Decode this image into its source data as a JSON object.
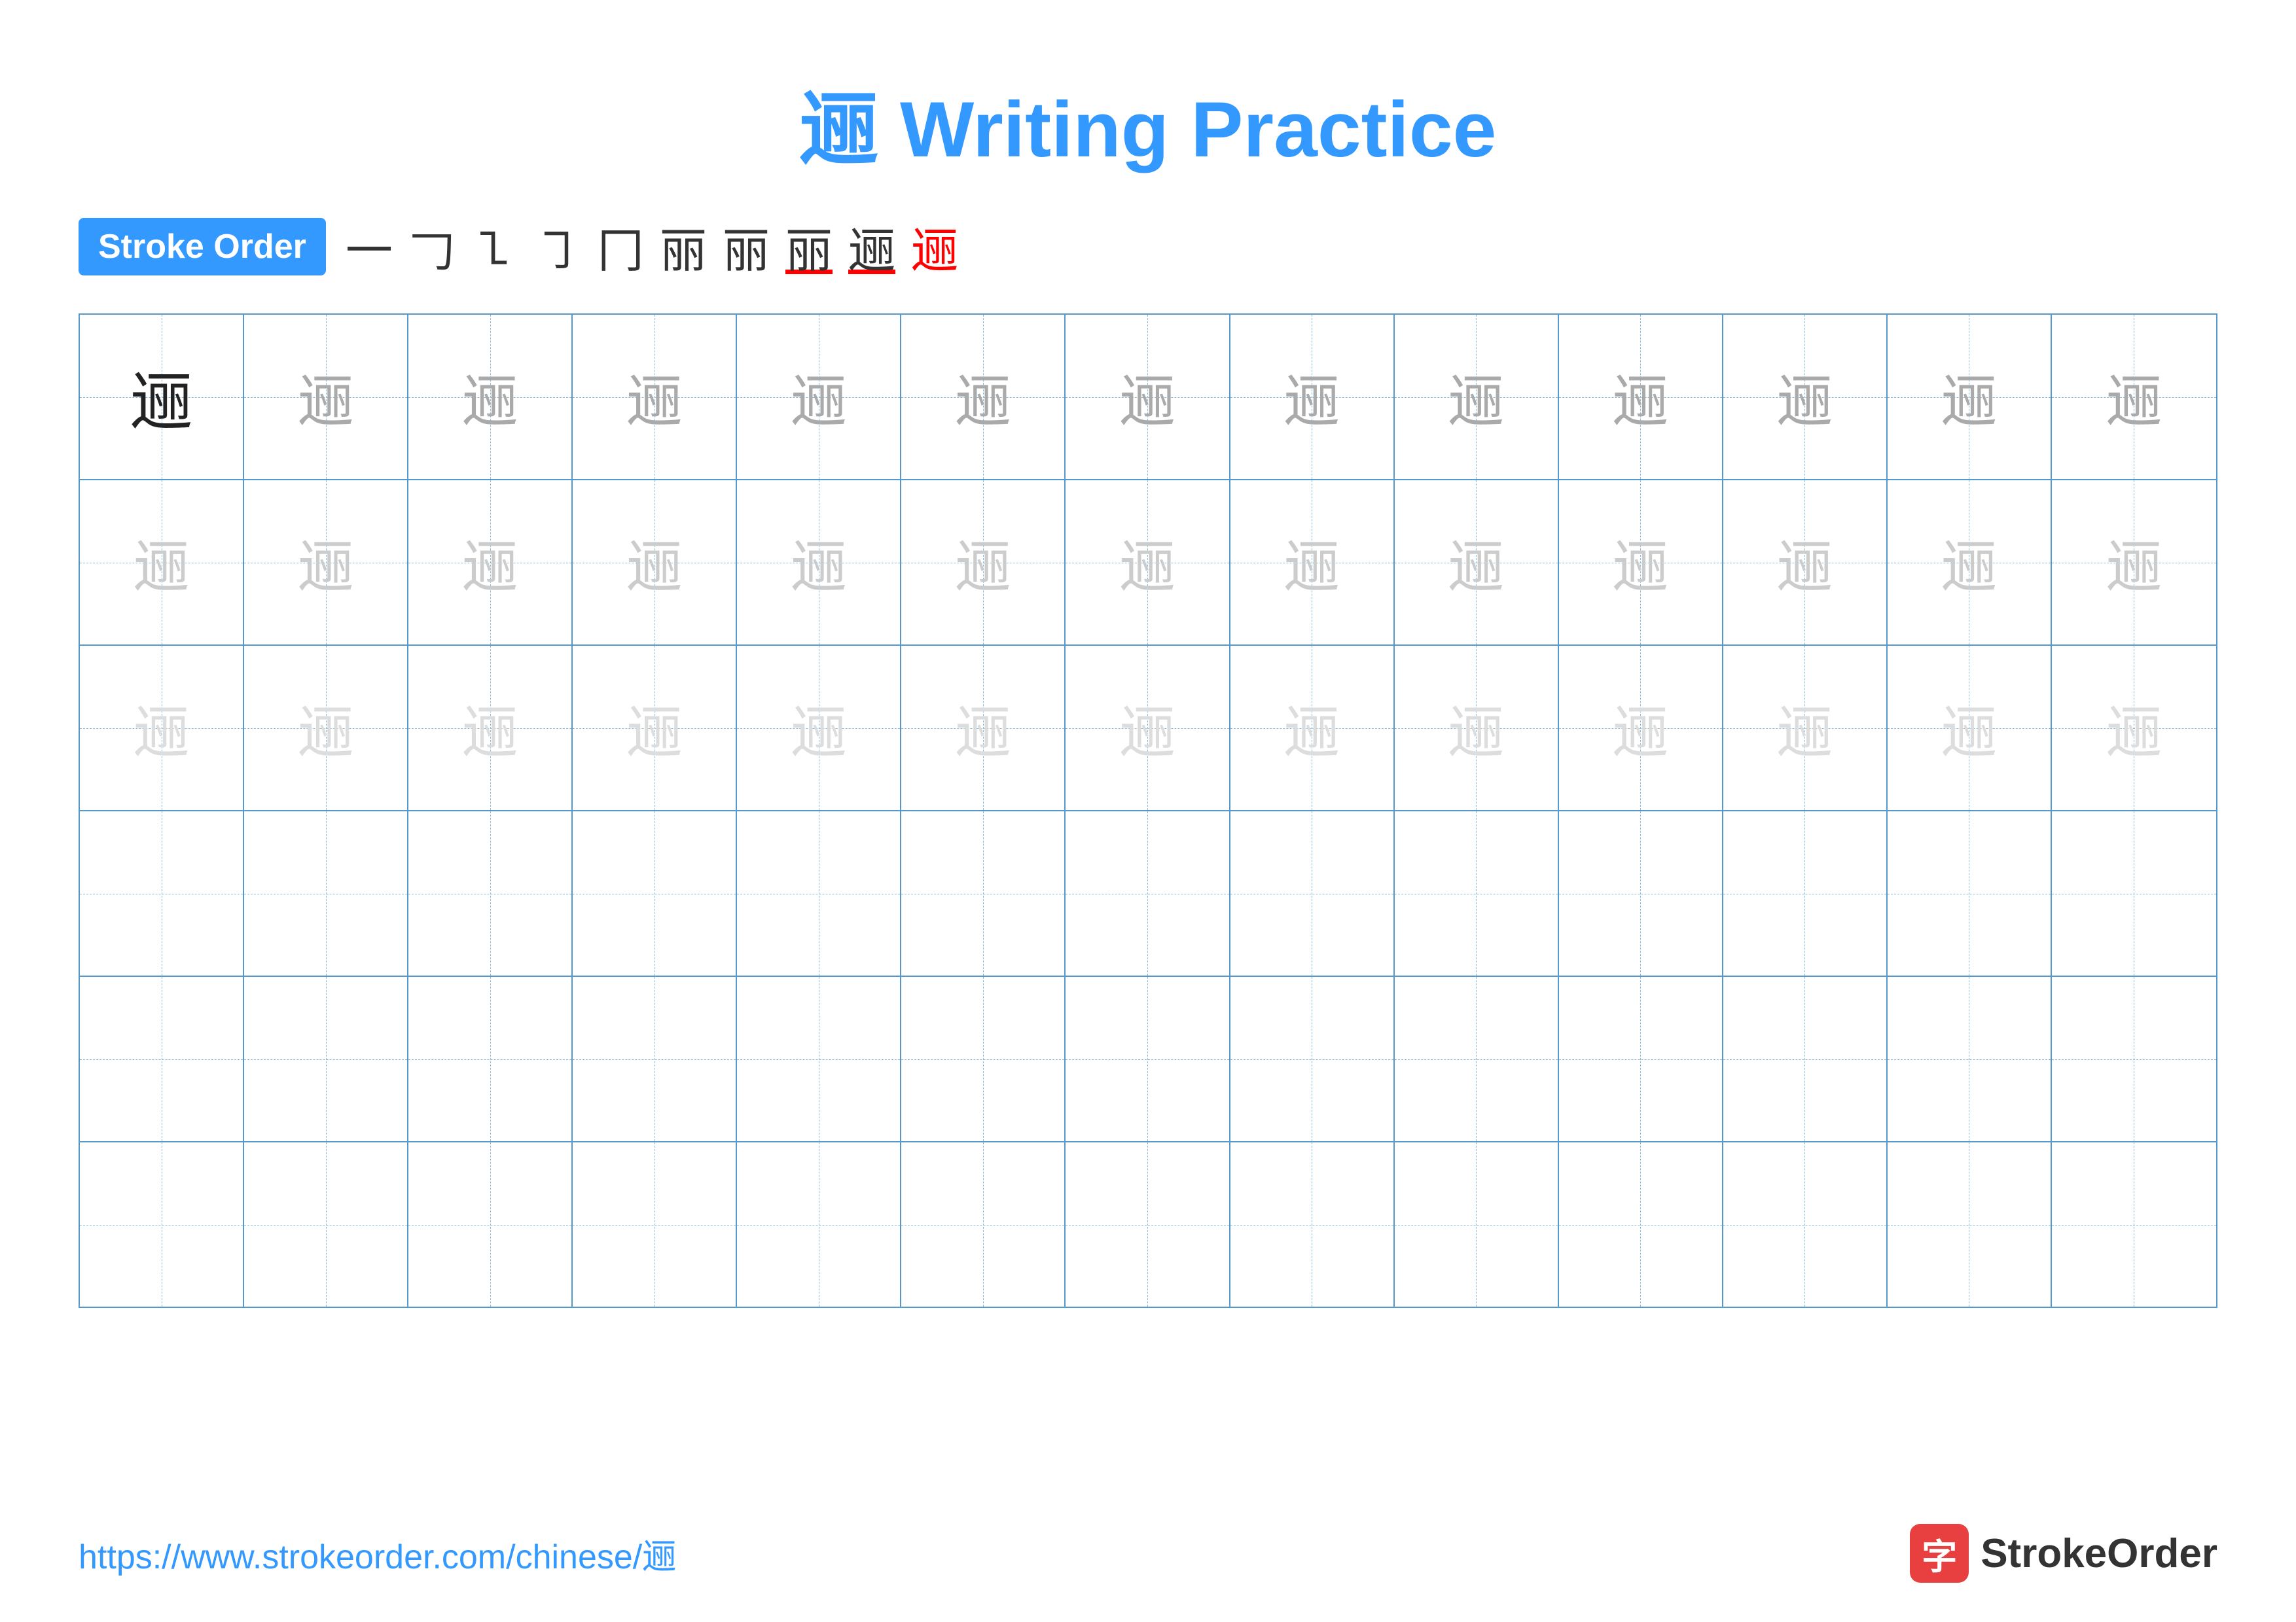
{
  "title": {
    "char": "逦",
    "text": "Writing Practice",
    "full": "逦 Writing Practice"
  },
  "stroke_order": {
    "badge_label": "Stroke Order",
    "steps": [
      "一",
      "𠃌",
      "𠃍",
      "𠃎",
      "𠃑",
      "丽",
      "丽",
      "丽",
      "逦",
      "逦"
    ]
  },
  "grid": {
    "rows": 6,
    "cols": 13,
    "char": "逦"
  },
  "footer": {
    "url": "https://www.strokeorder.com/chinese/逦",
    "brand_icon": "字",
    "brand_name": "StrokeOrder"
  }
}
